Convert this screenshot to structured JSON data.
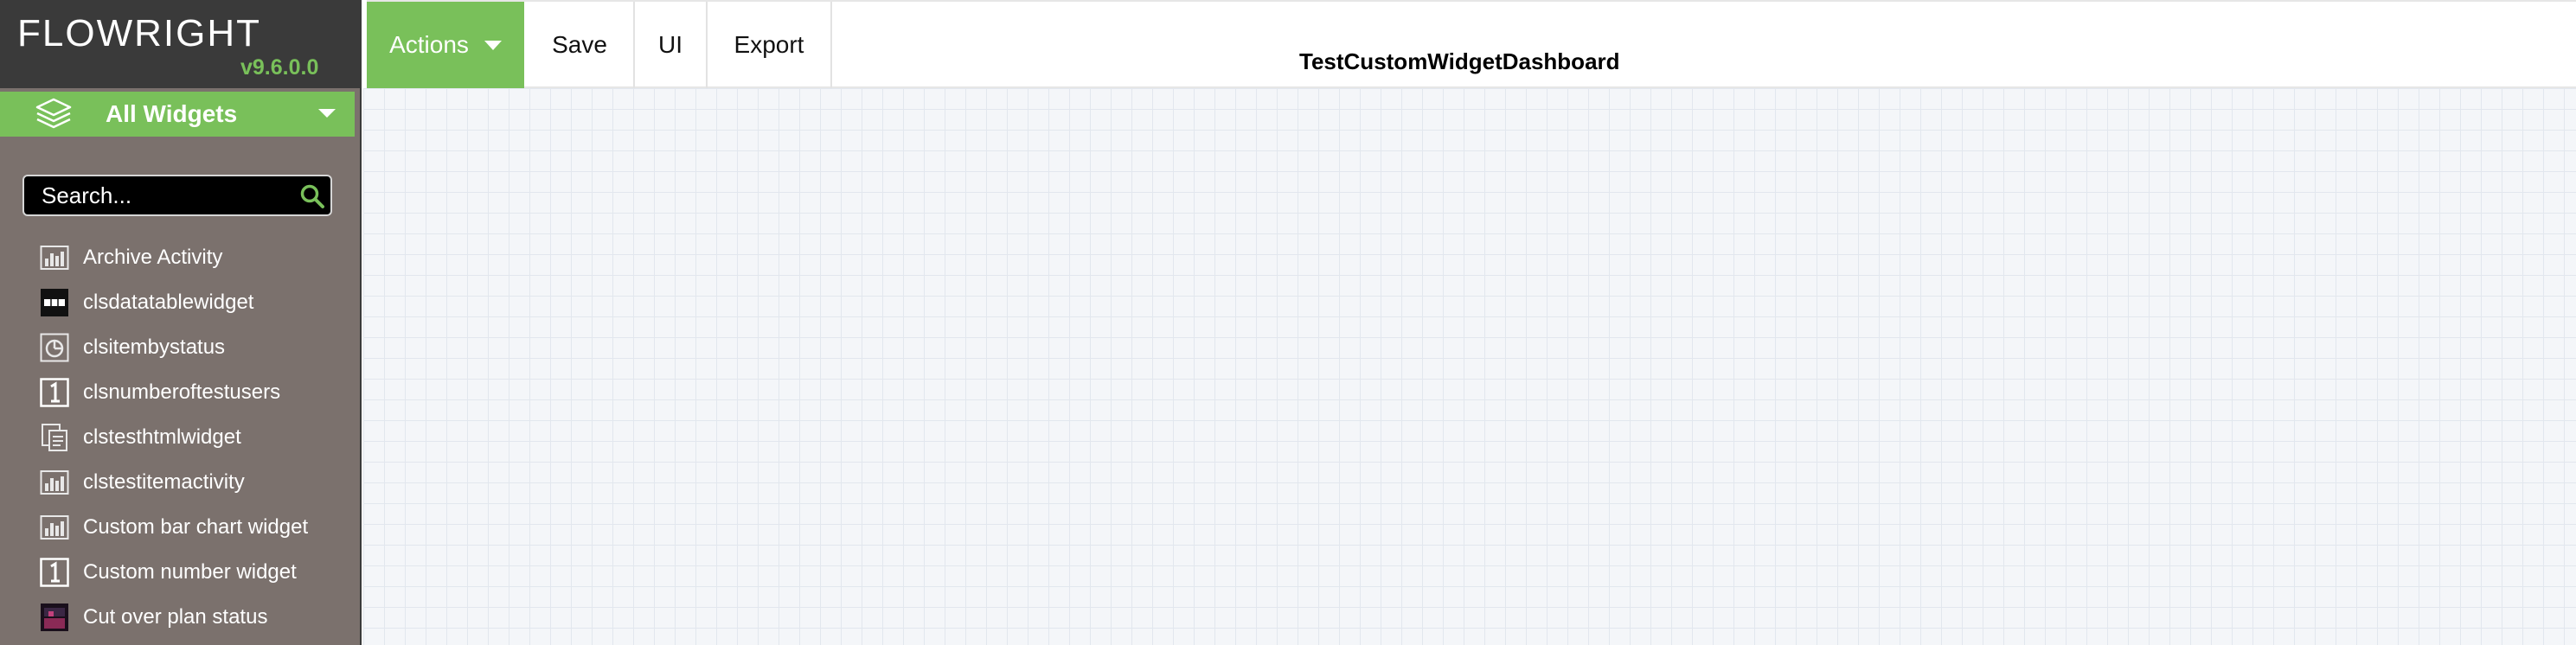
{
  "logo": {
    "text": "FLOWRIGHT",
    "version": "v9.6.0.0"
  },
  "widget_panel": {
    "header": "All Widgets",
    "search_placeholder": "Search...",
    "items": [
      {
        "label": "Archive Activity",
        "icon": "bar-chart-icon"
      },
      {
        "label": "clsdatatablewidget",
        "icon": "data-table-icon"
      },
      {
        "label": "clsitembystatus",
        "icon": "pie-chart-icon"
      },
      {
        "label": "clsnumberoftestusers",
        "icon": "number-icon"
      },
      {
        "label": "clstesthtmlwidget",
        "icon": "html-doc-icon"
      },
      {
        "label": "clstestitemactivity",
        "icon": "bar-chart-icon"
      },
      {
        "label": "Custom bar chart widget",
        "icon": "bar-chart-icon"
      },
      {
        "label": "Custom number widget",
        "icon": "number-icon"
      },
      {
        "label": "Cut over plan status",
        "icon": "status-image-icon"
      }
    ]
  },
  "toolbar": {
    "actions_label": "Actions",
    "save_label": "Save",
    "ui_label": "UI",
    "export_label": "Export"
  },
  "dashboard": {
    "title": "TestCustomWidgetDashboard"
  },
  "colors": {
    "accent": "#79c05a",
    "sidebar": "#7b716d",
    "logo_bg": "#3a3a3a"
  }
}
